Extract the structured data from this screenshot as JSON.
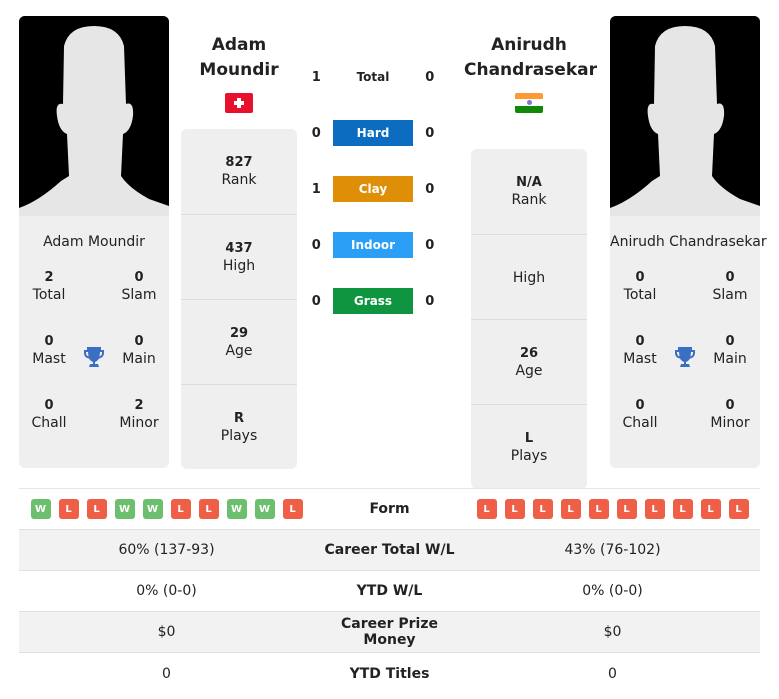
{
  "colors": {
    "hard": "#0b6cc0",
    "clay": "#df8e08",
    "indoor": "#2b9ef5",
    "grass": "#0f9540",
    "win": "#6cbf6c",
    "loss": "#ef5f48",
    "trophy": "#3a6fc1"
  },
  "player1": {
    "name_line1": "Adam",
    "name_line2": "Moundir",
    "full_name": "Adam Moundir",
    "flag": "switzerland-flag",
    "rank": "827",
    "rank_label": "Rank",
    "high": "437",
    "high_label": "High",
    "age": "29",
    "age_label": "Age",
    "plays": "R",
    "plays_label": "Plays",
    "titles": {
      "total": "2",
      "total_label": "Total",
      "slam": "0",
      "slam_label": "Slam",
      "mast": "0",
      "mast_label": "Mast",
      "main": "0",
      "main_label": "Main",
      "chall": "0",
      "chall_label": "Chall",
      "minor": "2",
      "minor_label": "Minor"
    },
    "form": [
      "W",
      "L",
      "L",
      "W",
      "W",
      "L",
      "L",
      "W",
      "W",
      "L"
    ],
    "career_wl": "60% (137-93)",
    "ytd_wl": "0% (0-0)",
    "prize": "$0",
    "ytd_titles": "0"
  },
  "player2": {
    "name_line1": "Anirudh",
    "name_line2": "Chandrasekar",
    "full_name": "Anirudh Chandrasekar",
    "flag": "india-flag",
    "rank": "N/A",
    "rank_label": "Rank",
    "high": "",
    "high_label": "High",
    "age": "26",
    "age_label": "Age",
    "plays": "L",
    "plays_label": "Plays",
    "titles": {
      "total": "0",
      "total_label": "Total",
      "slam": "0",
      "slam_label": "Slam",
      "mast": "0",
      "mast_label": "Mast",
      "main": "0",
      "main_label": "Main",
      "chall": "0",
      "chall_label": "Chall",
      "minor": "0",
      "minor_label": "Minor"
    },
    "form": [
      "L",
      "L",
      "L",
      "L",
      "L",
      "L",
      "L",
      "L",
      "L",
      "L"
    ],
    "career_wl": "43% (76-102)",
    "ytd_wl": "0% (0-0)",
    "prize": "$0",
    "ytd_titles": "0"
  },
  "h2h": [
    {
      "label": "Total",
      "p1": "1",
      "p2": "0",
      "key": "total"
    },
    {
      "label": "Hard",
      "p1": "0",
      "p2": "0",
      "key": "hard"
    },
    {
      "label": "Clay",
      "p1": "1",
      "p2": "0",
      "key": "clay"
    },
    {
      "label": "Indoor",
      "p1": "0",
      "p2": "0",
      "key": "indoor"
    },
    {
      "label": "Grass",
      "p1": "0",
      "p2": "0",
      "key": "grass"
    }
  ],
  "table": {
    "form_label": "Form",
    "career_label": "Career Total W/L",
    "ytd_label": "YTD W/L",
    "prize_label": "Career Prize Money",
    "titles_label": "YTD Titles"
  }
}
